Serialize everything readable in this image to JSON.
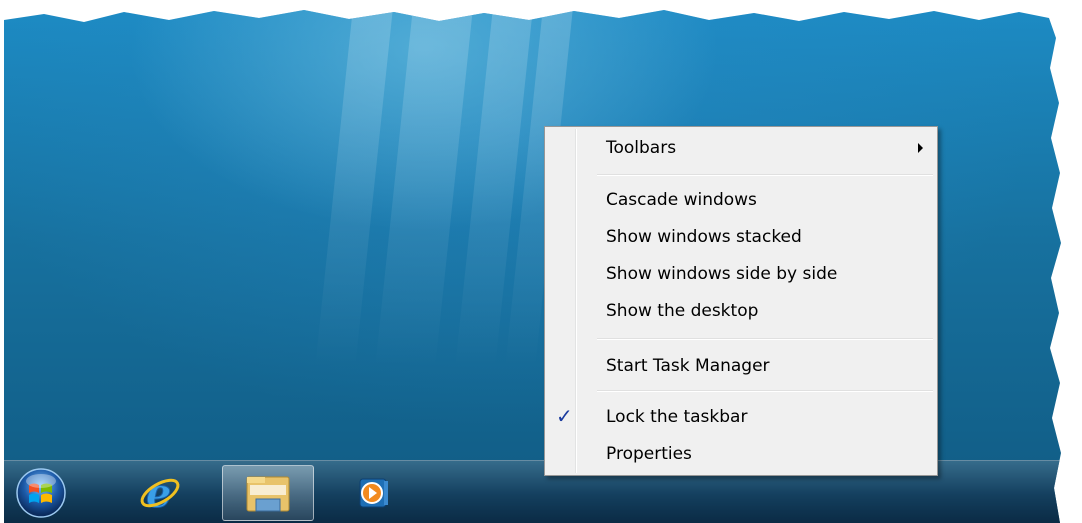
{
  "context_menu": {
    "items": [
      {
        "label": "Toolbars"
      },
      {
        "label": "Cascade windows"
      },
      {
        "label": "Show windows stacked"
      },
      {
        "label": "Show windows side by side"
      },
      {
        "label": "Show the desktop"
      },
      {
        "label": "Start Task Manager"
      },
      {
        "label": "Lock the taskbar",
        "checked": true
      },
      {
        "label": "Properties"
      }
    ],
    "check_glyph": "✓"
  },
  "taskbar": {
    "buttons": [
      {
        "icon": "windows-start-orb-icon"
      },
      {
        "icon": "internet-explorer-icon"
      },
      {
        "icon": "windows-explorer-icon",
        "active": true
      },
      {
        "icon": "windows-media-player-icon"
      }
    ]
  },
  "colors": {
    "desktop": "#17719f",
    "menu_bg": "#f0f0f0",
    "check": "#1a3b9e"
  }
}
